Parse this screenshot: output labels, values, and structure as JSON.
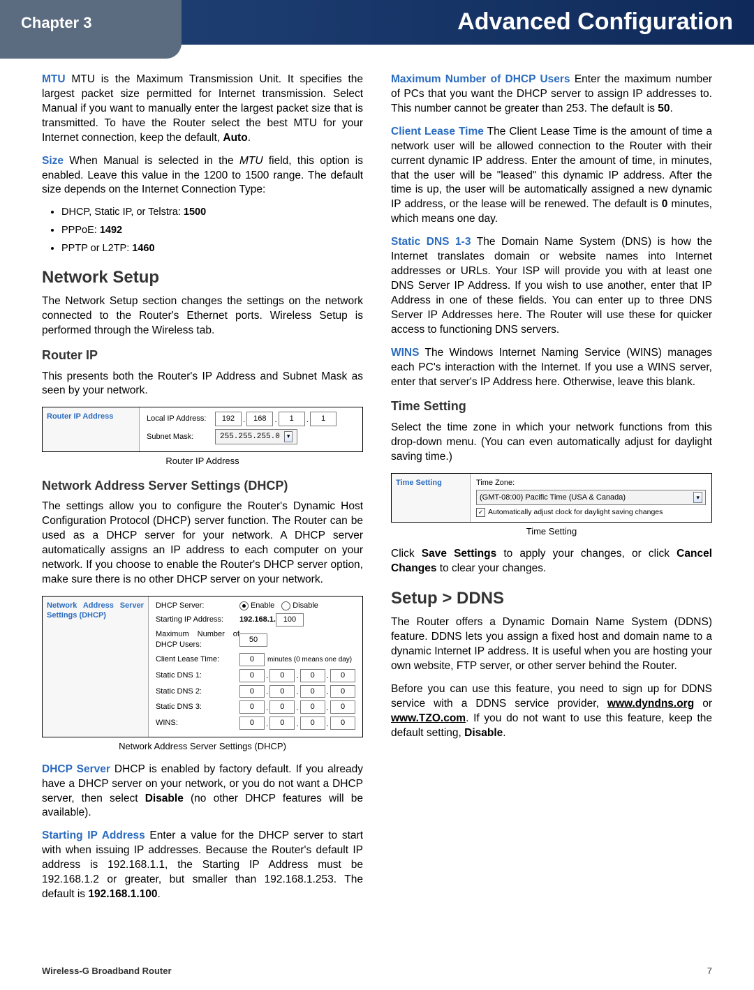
{
  "header": {
    "chapter": "Chapter 3",
    "title": "Advanced Configuration"
  },
  "mtu": {
    "term": "MTU",
    "text": "  MTU is the Maximum Transmission Unit. It specifies the largest packet size permitted for Internet transmission. Select Manual if you want to manually enter the largest packet size that is transmitted. To have the Router select the best MTU for your Internet connection, keep the default, ",
    "bold_tail": "Auto",
    "tail": "."
  },
  "size": {
    "term": "Size",
    "text": "  When Manual is selected in the ",
    "italic": "MTU",
    "text2": " field, this option is enabled. Leave this value in the 1200 to 1500 range. The default size depends on the Internet Connection Type:"
  },
  "size_list": [
    "DHCP, Static IP, or Telstra: 1500",
    "PPPoE: 1492",
    "PPTP or L2TP: 1460"
  ],
  "size_list_plain": [
    "DHCP, Static IP, or Telstra: ",
    "PPPoE: ",
    "PPTP or L2TP: "
  ],
  "size_list_bold": [
    "1500",
    "1492",
    "1460"
  ],
  "h2_network": "Network Setup",
  "network_setup_p": "The Network Setup section changes the settings on the network connected to the Router's Ethernet ports. Wireless Setup is performed through the Wireless tab.",
  "h3_routerip": "Router IP",
  "routerip_p": "This presents both the Router's IP Address and Subnet Mask as seen by your network.",
  "fig_routerip": {
    "side": "Router IP Address",
    "row1_label": "Local IP Address:",
    "ip": [
      "192",
      "168",
      "1",
      "1"
    ],
    "row2_label": "Subnet Mask:",
    "mask": "255.255.255.0",
    "caption": "Router IP Address"
  },
  "h3_dhcp": "Network Address Server Settings (DHCP)",
  "dhcp_p": "The settings allow you to configure the Router's Dynamic Host Configuration Protocol (DHCP) server function. The Router can be used as a DHCP server for your network. A DHCP server automatically assigns an IP address to each computer on your network. If you choose to enable the Router's DHCP server option, make sure there is no other DHCP server on your network.",
  "fig_dhcp": {
    "side": "Network Address Server Settings (DHCP)",
    "rows": {
      "dhcp_server": "DHCP Server:",
      "enable": "Enable",
      "disable": "Disable",
      "starting_ip": "Starting IP Address:",
      "starting_ip_prefix": "192.168.1.",
      "starting_ip_val": "100",
      "max_users": "Maximum Number of DHCP Users:",
      "max_users_val": "50",
      "lease_time": "Client Lease Time:",
      "lease_time_val": "0",
      "lease_unit": "minutes (0 means one day)",
      "static_dns1": "Static DNS 1:",
      "static_dns2": "Static DNS 2:",
      "static_dns3": "Static DNS 3:",
      "wins": "WINS:",
      "zeros": [
        "0",
        "0",
        "0",
        "0"
      ]
    },
    "caption": "Network Address Server Settings (DHCP)"
  },
  "dhcp_server": {
    "term": "DHCP Server",
    "text": "  DHCP is enabled by factory default. If you already have a DHCP server on your network, or you do not want a DHCP server, then select ",
    "bold": "Disable",
    "tail": " (no other DHCP features will be available)."
  },
  "starting_ip": {
    "term": "Starting IP Address",
    "text": "  Enter a value for the DHCP server to start with when issuing IP addresses. Because the Router's default IP address is 192.168.1.1, the Starting IP Address must be 192.168.1.2 or greater, but smaller than 192.168.1.253. The default is ",
    "bold": "192.168.1.100",
    "tail": "."
  },
  "max_users": {
    "term": "Maximum Number of DHCP Users",
    "text": "  Enter the maximum number of PCs that you want the DHCP server to assign IP addresses to. This number cannot be greater than 253. The default is ",
    "bold": "50",
    "tail": "."
  },
  "lease": {
    "term": "Client Lease Time",
    "text": "  The Client Lease Time is the amount of time a network user will be allowed connection to the Router with their current dynamic IP address. Enter the amount of time, in minutes, that the user will be \"leased\" this dynamic IP address. After the time is up, the user will be automatically assigned a new dynamic IP address, or the lease will be renewed. The default is ",
    "bold": "0",
    "tail": " minutes, which means one day."
  },
  "static_dns": {
    "term": "Static DNS 1-3",
    "text": "  The Domain Name System (DNS) is how the Internet translates domain or website names into Internet addresses or URLs. Your ISP will provide you with at least one DNS Server IP Address. If you wish to use another, enter that IP Address in one of these fields. You can enter up to three DNS Server IP Addresses here. The Router will use these for quicker access to functioning DNS servers."
  },
  "wins": {
    "term": "WINS",
    "text": "  The Windows Internet Naming Service (WINS) manages each PC's interaction with the Internet. If you use a WINS server, enter that server's IP Address here. Otherwise, leave this blank."
  },
  "h3_time": "Time Setting",
  "time_p": "Select the time zone in which your network functions from this drop-down menu. (You can even automatically adjust for daylight saving time.)",
  "fig_time": {
    "side": "Time Setting",
    "label": "Time Zone:",
    "value": "(GMT-08:00) Pacific Time (USA & Canada)",
    "cb_label": "Automatically adjust clock for daylight saving changes",
    "caption": "Time Setting"
  },
  "save_p": {
    "a": "Click ",
    "b": "Save Settings",
    "c": " to apply your changes, or click ",
    "d": "Cancel Changes",
    "e": " to clear your changes."
  },
  "h2_ddns": "Setup > DDNS",
  "ddns_p1": "The Router offers a Dynamic Domain Name System (DDNS) feature. DDNS lets you assign a fixed host and domain name to a dynamic Internet IP address. It is useful when you are hosting your own website, FTP server, or other server behind the Router.",
  "ddns_p2": {
    "a": "Before you can use this feature, you need to sign up for DDNS service with a DDNS service provider, ",
    "link1": "www.dyndns.org",
    "b": " or ",
    "link2": "www.TZO.com",
    "c": ". If you do not want to use this feature, keep the default setting, ",
    "bold": "Disable",
    "d": "."
  },
  "footer": {
    "product": "Wireless-G Broadband Router",
    "page": "7"
  }
}
